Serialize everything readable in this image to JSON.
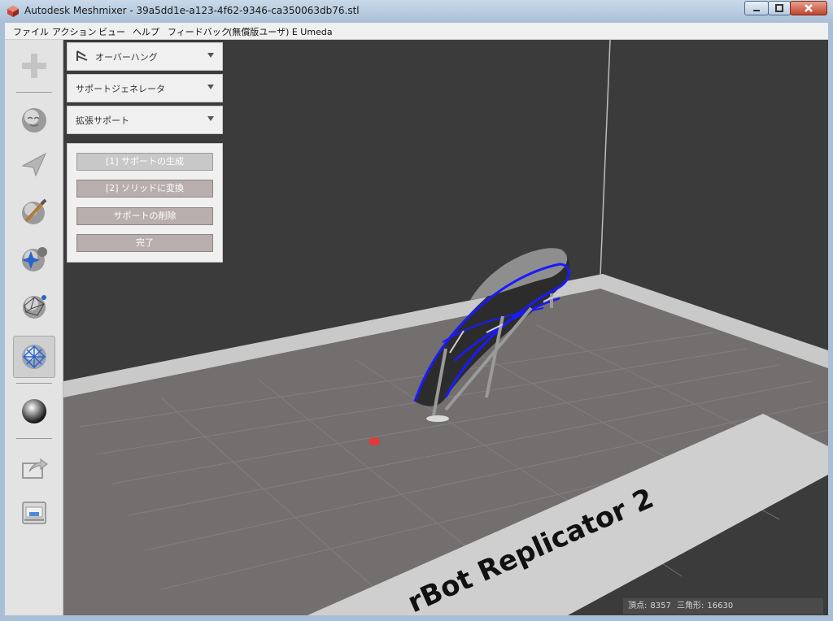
{
  "window": {
    "title": "Autodesk Meshmixer - 39a5dd1e-a123-4f62-9346-ca350063db76.stl"
  },
  "menu": [
    "ファイル",
    "アクション",
    "ビュー",
    "ヘルプ",
    "フィードバック",
    "(無償版ユーザ) E Umeda"
  ],
  "toolbar": {
    "tools": [
      {
        "name": "meshmix-add-icon"
      },
      {
        "name": "sculpt-icon"
      },
      {
        "name": "select-icon"
      },
      {
        "name": "edit-brush-icon"
      },
      {
        "name": "stamp-icon"
      },
      {
        "name": "analysis-icon"
      },
      {
        "name": "support-analysis-icon",
        "active": true
      },
      {
        "name": "shaders-icon"
      },
      {
        "name": "export-icon"
      },
      {
        "name": "print-icon"
      }
    ]
  },
  "panels": {
    "overhang": {
      "label": "オーバーハング"
    },
    "generator": {
      "label": "サポートジェネレータ"
    },
    "advanced": {
      "label": "拡張サポート"
    },
    "actions": {
      "generate": "[1] サポートの生成",
      "convert": "[2] ソリッドに変換",
      "remove": "サポートの削除",
      "done": "完了"
    }
  },
  "viewport": {
    "bed_label": "rBot Replicator 2",
    "colors": {
      "background": "#3b3b3b",
      "bed": "#737070",
      "bed_frame": "#cacaca",
      "support_edge": "#1a1aff"
    }
  },
  "status": {
    "vertices_label": "頂点:",
    "vertices_value": "8357",
    "triangles_label": "三角形:",
    "triangles_value": "16630"
  }
}
